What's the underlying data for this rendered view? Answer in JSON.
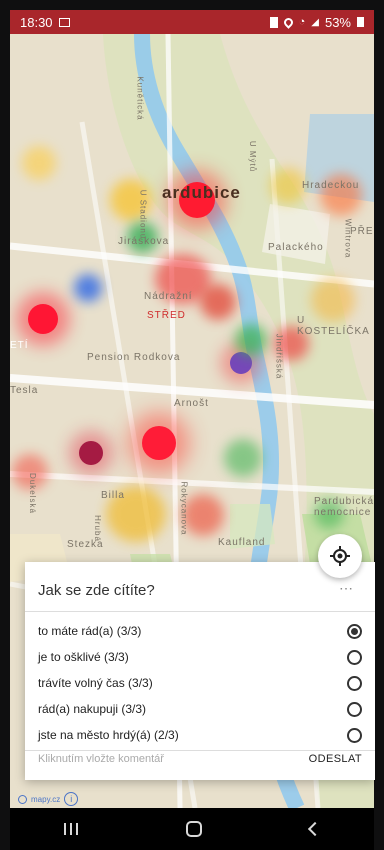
{
  "status": {
    "time": "18:30",
    "battery": "53%"
  },
  "map": {
    "district_labels": [
      "ardubice",
      "STŘED",
      "U KOSTELÍČKA",
      "PŘE",
      "ETÍ"
    ],
    "street_labels": [
      "Kunětická",
      "U Stadionu",
      "U Mýtů",
      "Hradeckou",
      "Wintrova",
      "Jindřišská",
      "Nádražní",
      "Jiráskova",
      "Palackého",
      "Arnošt",
      "Billa",
      "Rokycanova",
      "Kaufland",
      "Pension Rodkova",
      "Tesla",
      "Stezka",
      "Pardubická nemocnice",
      "Hrubá",
      "Dukelská"
    ],
    "heat_colors": [
      "#e3162b",
      "#ef7c22",
      "#f2c529",
      "#37b24d",
      "#2b7dd4",
      "#8c4bd4"
    ]
  },
  "bottom_sheet": {
    "title": "Jak se zde cítíte?",
    "options": [
      {
        "label": "to máte rád(a) (3/3)",
        "selected": true
      },
      {
        "label": "je to ošklivé (3/3)",
        "selected": false
      },
      {
        "label": "trávíte volný čas (3/3)",
        "selected": false
      },
      {
        "label": "rád(a) nakupuji (3/3)",
        "selected": false
      },
      {
        "label": "jste na město hrdý(á) (2/3)",
        "selected": false
      }
    ],
    "comment_placeholder": "Kliknutím vložte komentář",
    "send_label": "ODESLAT"
  },
  "attribution": {
    "text": "mapy.cz",
    "info_label": "i"
  },
  "icons": {
    "photo": "image-icon",
    "battery": "battery-icon",
    "location": "location-icon",
    "wifi": "wifi-icon",
    "signal": "signal-icon",
    "locate": "crosshair-icon",
    "dots": "ellipsis-icon",
    "recent_apps": "recent-apps-icon",
    "home": "home-icon",
    "back": "back-icon"
  }
}
